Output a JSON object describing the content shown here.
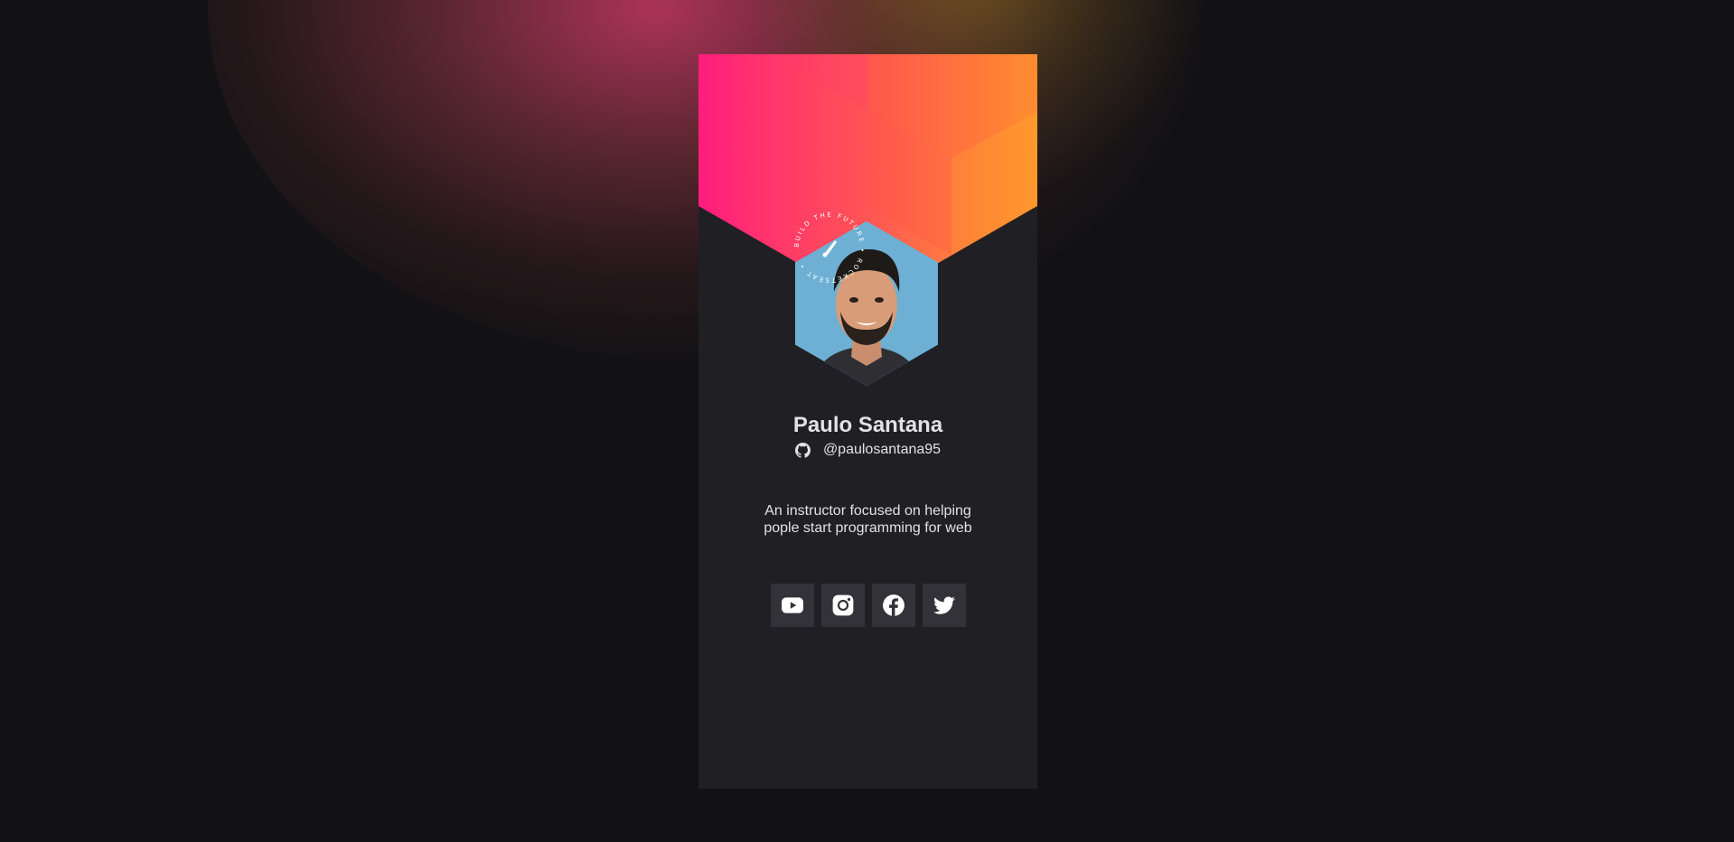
{
  "profile": {
    "name": "Paulo Santana",
    "github_handle": "@paulosantana95",
    "bio_lines": [
      "An instructor focused on helping",
      "pople start programming for web"
    ],
    "badge_text": "BUILD THE FUTURE • ROCKETSEAT •"
  },
  "socials": [
    {
      "icon": "youtube-icon",
      "label": "YouTube"
    },
    {
      "icon": "instagram-icon",
      "label": "Instagram"
    },
    {
      "icon": "facebook-icon",
      "label": "Facebook"
    },
    {
      "icon": "twitter-icon",
      "label": "Twitter"
    }
  ],
  "colors": {
    "background": "#121214",
    "card": "#202024",
    "button": "#323238",
    "text": "#e1e1e6",
    "gradient_start": "#ff1d7c",
    "gradient_end": "#ffa12a"
  }
}
